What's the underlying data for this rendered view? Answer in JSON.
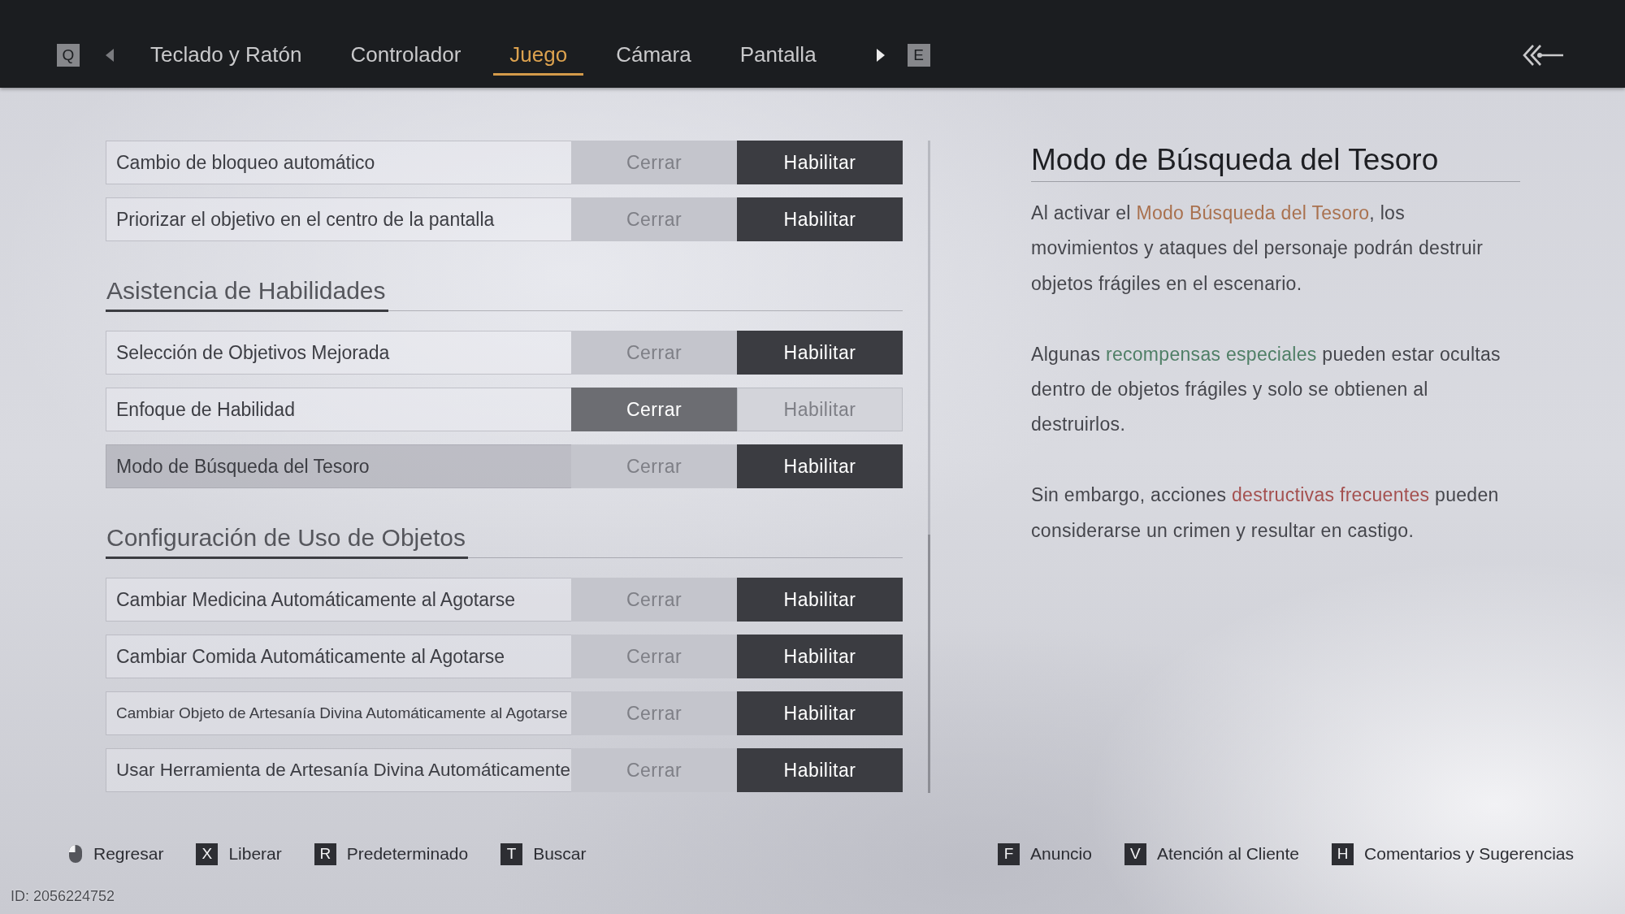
{
  "top_bar": {
    "prev_key": "Q",
    "tabs": [
      {
        "label": "Teclado y Ratón",
        "selected": false
      },
      {
        "label": "Controlador",
        "selected": false
      },
      {
        "label": "Juego",
        "selected": true
      },
      {
        "label": "Cámara",
        "selected": false
      },
      {
        "label": "Pantalla",
        "selected": false
      }
    ],
    "next_key": "E"
  },
  "settings": [
    {
      "rows": [
        {
          "label": "Cambio de bloqueo automático",
          "focused": false,
          "options": [
            {
              "label": "Cerrar",
              "selected": false
            },
            {
              "label": "Habilitar",
              "selected": true
            }
          ]
        },
        {
          "label": "Priorizar el objetivo en el centro de la pantalla",
          "focused": false,
          "options": [
            {
              "label": "Cerrar",
              "selected": false
            },
            {
              "label": "Habilitar",
              "selected": true
            }
          ]
        }
      ]
    },
    {
      "heading": "Asistencia de Habilidades",
      "rows": [
        {
          "label": "Selección de Objetivos Mejorada",
          "focused": false,
          "options": [
            {
              "label": "Cerrar",
              "selected": false
            },
            {
              "label": "Habilitar",
              "selected": true
            }
          ]
        },
        {
          "label": "Enfoque de Habilidad",
          "focused": false,
          "options": [
            {
              "label": "Cerrar",
              "selected": true
            },
            {
              "label": "Habilitar",
              "selected": false
            }
          ]
        },
        {
          "label": "Modo de Búsqueda del Tesoro",
          "focused": true,
          "options": [
            {
              "label": "Cerrar",
              "selected": false
            },
            {
              "label": "Habilitar",
              "selected": true
            }
          ]
        }
      ]
    },
    {
      "heading": "Configuración de Uso de Objetos",
      "rows": [
        {
          "label": "Cambiar Medicina Automáticamente al Agotarse",
          "focused": false,
          "options": [
            {
              "label": "Cerrar",
              "selected": false
            },
            {
              "label": "Habilitar",
              "selected": true
            }
          ]
        },
        {
          "label": "Cambiar Comida Automáticamente al Agotarse",
          "focused": false,
          "options": [
            {
              "label": "Cerrar",
              "selected": false
            },
            {
              "label": "Habilitar",
              "selected": true
            }
          ]
        },
        {
          "label": "Cambiar Objeto de Artesanía Divina Automáticamente al Agotarse",
          "focused": false,
          "options": [
            {
              "label": "Cerrar",
              "selected": false
            },
            {
              "label": "Habilitar",
              "selected": true
            }
          ]
        },
        {
          "label": "Usar Herramienta de Artesanía Divina Automáticamente",
          "focused": false,
          "options": [
            {
              "label": "Cerrar",
              "selected": false
            },
            {
              "label": "Habilitar",
              "selected": true
            }
          ]
        }
      ]
    }
  ],
  "description": {
    "title": "Modo de Búsqueda del Tesoro",
    "paragraphs": [
      {
        "runs": [
          {
            "text": "Al activar el "
          },
          {
            "text": "Modo Búsqueda del Tesoro",
            "color": "#a9714f"
          },
          {
            "text": ", los movimientos y ataques del personaje podrán destruir objetos frágiles en el escenario."
          }
        ]
      },
      {
        "runs": [
          {
            "text": "Algunas "
          },
          {
            "text": "recompensas especiales",
            "color": "#4f7f66"
          },
          {
            "text": " pueden estar ocultas dentro de objetos frágiles y solo se obtienen al destruirlos."
          }
        ]
      },
      {
        "runs": [
          {
            "text": "Sin embargo, acciones "
          },
          {
            "text": "destructivas frecuentes",
            "color": "#a4504f"
          },
          {
            "text": " pueden considerarse un crimen y resultar en castigo."
          }
        ]
      }
    ]
  },
  "hints": {
    "left": [
      {
        "kind": "mouse",
        "label": "Regresar"
      },
      {
        "kind": "key",
        "key": "X",
        "label": "Liberar"
      },
      {
        "kind": "key",
        "key": "R",
        "label": "Predeterminado"
      },
      {
        "kind": "key",
        "key": "T",
        "label": "Buscar"
      }
    ],
    "right": [
      {
        "kind": "key",
        "key": "F",
        "label": "Anuncio"
      },
      {
        "kind": "key",
        "key": "V",
        "label": "Atención al Cliente"
      },
      {
        "kind": "key",
        "key": "H",
        "label": "Comentarios y Sugerencias"
      }
    ]
  },
  "user_id": "ID: 2056224752"
}
